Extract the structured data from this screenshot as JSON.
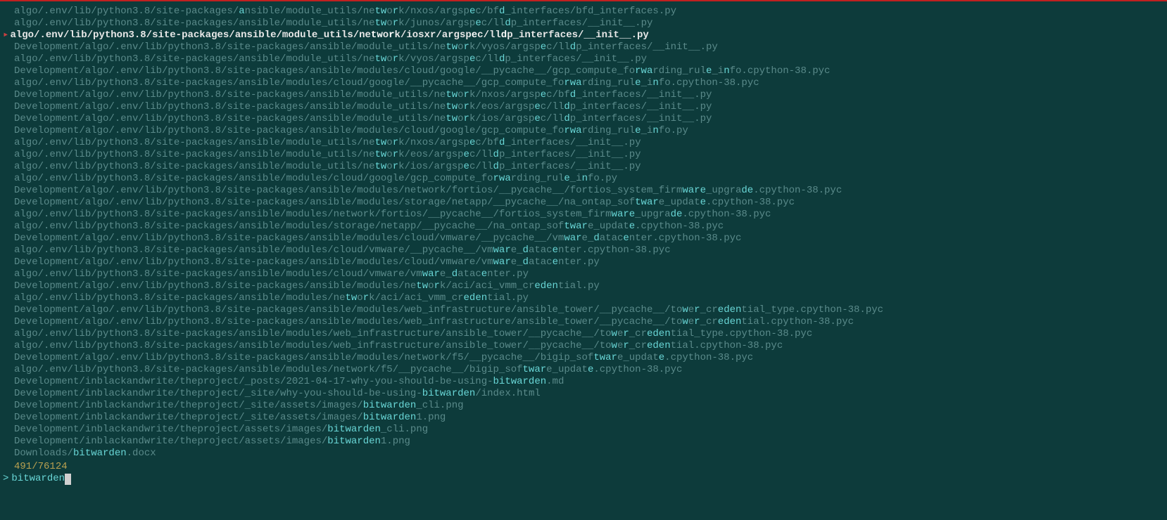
{
  "lines": [
    {
      "sel": false,
      "segs": [
        {
          "t": "algo/.env/lib/python3.8/site-packages/"
        },
        {
          "t": "a",
          "h": true
        },
        {
          "t": "nsible/module_utils/ne"
        },
        {
          "t": "tw",
          "h": true
        },
        {
          "t": "o"
        },
        {
          "t": "r",
          "h": true
        },
        {
          "t": "k/nxos/argsp"
        },
        {
          "t": "e",
          "h": true
        },
        {
          "t": "c/bf"
        },
        {
          "t": "d",
          "h": true
        },
        {
          "t": "_interfaces/bfd_interfaces.py"
        }
      ]
    },
    {
      "sel": false,
      "segs": [
        {
          "t": "algo/.env/lib/python3.8/site-packages/ansible/module_utils/ne"
        },
        {
          "t": "tw",
          "h": true
        },
        {
          "t": "o"
        },
        {
          "t": "r",
          "h": true
        },
        {
          "t": "k/junos/argsp"
        },
        {
          "t": "e",
          "h": true
        },
        {
          "t": "c/ll"
        },
        {
          "t": "d",
          "h": true
        },
        {
          "t": "p_interfaces/__init__.py"
        }
      ]
    },
    {
      "sel": true,
      "segs": [
        {
          "t": "algo/.env/lib/python3.8/site-packages/ansible/module_utils/ne"
        },
        {
          "t": "tw",
          "h": true
        },
        {
          "t": "o"
        },
        {
          "t": "r",
          "h": true
        },
        {
          "t": "k/iosxr/argsp"
        },
        {
          "t": "e",
          "h": true
        },
        {
          "t": "c/ll"
        },
        {
          "t": "d",
          "h": true
        },
        {
          "t": "p_interfaces/__init__.py"
        }
      ]
    },
    {
      "sel": false,
      "segs": [
        {
          "t": "Development/algo/.env/lib/python3.8/site-packages/ansible/module_utils/ne"
        },
        {
          "t": "tw",
          "h": true
        },
        {
          "t": "o"
        },
        {
          "t": "r",
          "h": true
        },
        {
          "t": "k/vyos/argsp"
        },
        {
          "t": "e",
          "h": true
        },
        {
          "t": "c/ll"
        },
        {
          "t": "d",
          "h": true
        },
        {
          "t": "p_interfaces/__init__.py"
        }
      ]
    },
    {
      "sel": false,
      "segs": [
        {
          "t": "algo/.env/lib/python3.8/site-packages/ansible/module_utils/ne"
        },
        {
          "t": "tw",
          "h": true
        },
        {
          "t": "o"
        },
        {
          "t": "r",
          "h": true
        },
        {
          "t": "k/vyos/argsp"
        },
        {
          "t": "e",
          "h": true
        },
        {
          "t": "c/ll"
        },
        {
          "t": "d",
          "h": true
        },
        {
          "t": "p_interfaces/__init__.py"
        }
      ]
    },
    {
      "sel": false,
      "segs": [
        {
          "t": "Development/algo/.env/lib/python3.8/site-packages/ansible/modules/cloud/google/__pycache__/gcp_compute_fo"
        },
        {
          "t": "rwa",
          "h": true
        },
        {
          "t": "rding_rul"
        },
        {
          "t": "e",
          "h": true
        },
        {
          "t": "_i"
        },
        {
          "t": "n",
          "h": true
        },
        {
          "t": "fo.cpython-38.pyc"
        }
      ]
    },
    {
      "sel": false,
      "segs": [
        {
          "t": "algo/.env/lib/python3.8/site-packages/ansible/modules/cloud/google/__pycache__/gcp_compute_fo"
        },
        {
          "t": "rwa",
          "h": true
        },
        {
          "t": "rding_rul"
        },
        {
          "t": "e",
          "h": true
        },
        {
          "t": "_i"
        },
        {
          "t": "n",
          "h": true
        },
        {
          "t": "fo.cpython-38.pyc"
        }
      ]
    },
    {
      "sel": false,
      "segs": [
        {
          "t": "Development/algo/.env/lib/python3.8/site-packages/ansible/module_utils/ne"
        },
        {
          "t": "tw",
          "h": true
        },
        {
          "t": "o"
        },
        {
          "t": "r",
          "h": true
        },
        {
          "t": "k/nxos/argsp"
        },
        {
          "t": "e",
          "h": true
        },
        {
          "t": "c/bf"
        },
        {
          "t": "d",
          "h": true
        },
        {
          "t": "_interfaces/__init__.py"
        }
      ]
    },
    {
      "sel": false,
      "segs": [
        {
          "t": "Development/algo/.env/lib/python3.8/site-packages/ansible/module_utils/ne"
        },
        {
          "t": "tw",
          "h": true
        },
        {
          "t": "o"
        },
        {
          "t": "r",
          "h": true
        },
        {
          "t": "k/eos/argsp"
        },
        {
          "t": "e",
          "h": true
        },
        {
          "t": "c/ll"
        },
        {
          "t": "d",
          "h": true
        },
        {
          "t": "p_interfaces/__init__.py"
        }
      ]
    },
    {
      "sel": false,
      "segs": [
        {
          "t": "Development/algo/.env/lib/python3.8/site-packages/ansible/module_utils/ne"
        },
        {
          "t": "tw",
          "h": true
        },
        {
          "t": "o"
        },
        {
          "t": "r",
          "h": true
        },
        {
          "t": "k/ios/argsp"
        },
        {
          "t": "e",
          "h": true
        },
        {
          "t": "c/ll"
        },
        {
          "t": "d",
          "h": true
        },
        {
          "t": "p_interfaces/__init__.py"
        }
      ]
    },
    {
      "sel": false,
      "segs": [
        {
          "t": "Development/algo/.env/lib/python3.8/site-packages/ansible/modules/cloud/google/gcp_compute_fo"
        },
        {
          "t": "rwa",
          "h": true
        },
        {
          "t": "rding_rul"
        },
        {
          "t": "e",
          "h": true
        },
        {
          "t": "_i"
        },
        {
          "t": "n",
          "h": true
        },
        {
          "t": "fo.py"
        }
      ]
    },
    {
      "sel": false,
      "segs": [
        {
          "t": "algo/.env/lib/python3.8/site-packages/ansible/module_utils/ne"
        },
        {
          "t": "tw",
          "h": true
        },
        {
          "t": "o"
        },
        {
          "t": "r",
          "h": true
        },
        {
          "t": "k/nxos/argsp"
        },
        {
          "t": "e",
          "h": true
        },
        {
          "t": "c/bf"
        },
        {
          "t": "d",
          "h": true
        },
        {
          "t": "_interfaces/__init__.py"
        }
      ]
    },
    {
      "sel": false,
      "segs": [
        {
          "t": "algo/.env/lib/python3.8/site-packages/ansible/module_utils/ne"
        },
        {
          "t": "tw",
          "h": true
        },
        {
          "t": "o"
        },
        {
          "t": "r",
          "h": true
        },
        {
          "t": "k/eos/argsp"
        },
        {
          "t": "e",
          "h": true
        },
        {
          "t": "c/ll"
        },
        {
          "t": "d",
          "h": true
        },
        {
          "t": "p_interfaces/__init__.py"
        }
      ]
    },
    {
      "sel": false,
      "segs": [
        {
          "t": "algo/.env/lib/python3.8/site-packages/ansible/module_utils/ne"
        },
        {
          "t": "tw",
          "h": true
        },
        {
          "t": "o"
        },
        {
          "t": "r",
          "h": true
        },
        {
          "t": "k/ios/argsp"
        },
        {
          "t": "e",
          "h": true
        },
        {
          "t": "c/ll"
        },
        {
          "t": "d",
          "h": true
        },
        {
          "t": "p_interfaces/__init__.py"
        }
      ]
    },
    {
      "sel": false,
      "segs": [
        {
          "t": "algo/.env/lib/python3.8/site-packages/ansible/modules/cloud/google/gcp_compute_fo"
        },
        {
          "t": "rwa",
          "h": true
        },
        {
          "t": "rding_rul"
        },
        {
          "t": "e",
          "h": true
        },
        {
          "t": "_i"
        },
        {
          "t": "n",
          "h": true
        },
        {
          "t": "fo.py"
        }
      ]
    },
    {
      "sel": false,
      "segs": [
        {
          "t": "Development/algo/.env/lib/python3.8/site-packages/ansible/modules/network/fortios/__pycache__/fortios_system_firm"
        },
        {
          "t": "ware",
          "h": true
        },
        {
          "t": "_upgra"
        },
        {
          "t": "de",
          "h": true
        },
        {
          "t": ".cpython-38.pyc"
        }
      ]
    },
    {
      "sel": false,
      "segs": [
        {
          "t": "Development/algo/.env/lib/python3.8/site-packages/ansible/modules/storage/netapp/__pycache__/na_ontap_sof"
        },
        {
          "t": "twar",
          "h": true
        },
        {
          "t": "e_updat"
        },
        {
          "t": "e",
          "h": true
        },
        {
          "t": ".cpython-38.pyc"
        }
      ]
    },
    {
      "sel": false,
      "segs": [
        {
          "t": "algo/.env/lib/python3.8/site-packages/ansible/modules/network/fortios/__pycache__/fortios_system_firm"
        },
        {
          "t": "ware",
          "h": true
        },
        {
          "t": "_upgra"
        },
        {
          "t": "de",
          "h": true
        },
        {
          "t": ".cpython-38.pyc"
        }
      ]
    },
    {
      "sel": false,
      "segs": [
        {
          "t": "algo/.env/lib/python3.8/site-packages/ansible/modules/storage/netapp/__pycache__/na_ontap_sof"
        },
        {
          "t": "twar",
          "h": true
        },
        {
          "t": "e_updat"
        },
        {
          "t": "e",
          "h": true
        },
        {
          "t": ".cpython-38.pyc"
        }
      ]
    },
    {
      "sel": false,
      "segs": [
        {
          "t": "Development/algo/.env/lib/python3.8/site-packages/ansible/modules/cloud/vmware/__pycache__/vm"
        },
        {
          "t": "war",
          "h": true
        },
        {
          "t": "e_"
        },
        {
          "t": "d",
          "h": true
        },
        {
          "t": "atac"
        },
        {
          "t": "e",
          "h": true
        },
        {
          "t": "nter.cpython-38.pyc"
        }
      ]
    },
    {
      "sel": false,
      "segs": [
        {
          "t": "algo/.env/lib/python3.8/site-packages/ansible/modules/cloud/vmware/__pycache__/vm"
        },
        {
          "t": "war",
          "h": true
        },
        {
          "t": "e_"
        },
        {
          "t": "d",
          "h": true
        },
        {
          "t": "atac"
        },
        {
          "t": "e",
          "h": true
        },
        {
          "t": "nter.cpython-38.pyc"
        }
      ]
    },
    {
      "sel": false,
      "segs": [
        {
          "t": "Development/algo/.env/lib/python3.8/site-packages/ansible/modules/cloud/vmware/vm"
        },
        {
          "t": "war",
          "h": true
        },
        {
          "t": "e_"
        },
        {
          "t": "d",
          "h": true
        },
        {
          "t": "atac"
        },
        {
          "t": "e",
          "h": true
        },
        {
          "t": "nter.py"
        }
      ]
    },
    {
      "sel": false,
      "segs": [
        {
          "t": "algo/.env/lib/python3.8/site-packages/ansible/modules/cloud/vmware/vm"
        },
        {
          "t": "war",
          "h": true
        },
        {
          "t": "e_"
        },
        {
          "t": "d",
          "h": true
        },
        {
          "t": "atac"
        },
        {
          "t": "e",
          "h": true
        },
        {
          "t": "nter.py"
        }
      ]
    },
    {
      "sel": false,
      "segs": [
        {
          "t": "Development/algo/.env/lib/python3.8/site-packages/ansible/modules/ne"
        },
        {
          "t": "tw",
          "h": true
        },
        {
          "t": "o"
        },
        {
          "t": "r",
          "h": true
        },
        {
          "t": "k/aci/aci_vmm_cr"
        },
        {
          "t": "eden",
          "h": true
        },
        {
          "t": "tial.py"
        }
      ]
    },
    {
      "sel": false,
      "segs": [
        {
          "t": "algo/.env/lib/python3.8/site-packages/ansible/modules/ne"
        },
        {
          "t": "tw",
          "h": true
        },
        {
          "t": "o"
        },
        {
          "t": "r",
          "h": true
        },
        {
          "t": "k/aci/aci_vmm_cr"
        },
        {
          "t": "eden",
          "h": true
        },
        {
          "t": "tial.py"
        }
      ]
    },
    {
      "sel": false,
      "segs": [
        {
          "t": "Development/algo/.env/lib/python3.8/site-packages/ansible/modules/web_infrastructure/ansible_tower/__pycache__/to"
        },
        {
          "t": "w",
          "h": true
        },
        {
          "t": "e"
        },
        {
          "t": "r",
          "h": true
        },
        {
          "t": "_cr"
        },
        {
          "t": "eden",
          "h": true
        },
        {
          "t": "tial_type.cpython-38.pyc"
        }
      ]
    },
    {
      "sel": false,
      "segs": [
        {
          "t": "Development/algo/.env/lib/python3.8/site-packages/ansible/modules/web_infrastructure/ansible_tower/__pycache__/to"
        },
        {
          "t": "w",
          "h": true
        },
        {
          "t": "e"
        },
        {
          "t": "r",
          "h": true
        },
        {
          "t": "_cr"
        },
        {
          "t": "eden",
          "h": true
        },
        {
          "t": "tial.cpython-38.pyc"
        }
      ]
    },
    {
      "sel": false,
      "segs": [
        {
          "t": "algo/.env/lib/python3.8/site-packages/ansible/modules/web_infrastructure/ansible_tower/__pycache__/to"
        },
        {
          "t": "w",
          "h": true
        },
        {
          "t": "e"
        },
        {
          "t": "r",
          "h": true
        },
        {
          "t": "_cr"
        },
        {
          "t": "eden",
          "h": true
        },
        {
          "t": "tial_type.cpython-38.pyc"
        }
      ]
    },
    {
      "sel": false,
      "segs": [
        {
          "t": "algo/.env/lib/python3.8/site-packages/ansible/modules/web_infrastructure/ansible_tower/__pycache__/to"
        },
        {
          "t": "w",
          "h": true
        },
        {
          "t": "e"
        },
        {
          "t": "r",
          "h": true
        },
        {
          "t": "_cr"
        },
        {
          "t": "eden",
          "h": true
        },
        {
          "t": "tial.cpython-38.pyc"
        }
      ]
    },
    {
      "sel": false,
      "segs": [
        {
          "t": "Development/algo/.env/lib/python3.8/site-packages/ansible/modules/network/f5/__pycache__/bigip_sof"
        },
        {
          "t": "twar",
          "h": true
        },
        {
          "t": "e_updat"
        },
        {
          "t": "e",
          "h": true
        },
        {
          "t": ".cpython-38.pyc"
        }
      ]
    },
    {
      "sel": false,
      "segs": [
        {
          "t": "algo/.env/lib/python3.8/site-packages/ansible/modules/network/f5/__pycache__/bigip_sof"
        },
        {
          "t": "twar",
          "h": true
        },
        {
          "t": "e_updat"
        },
        {
          "t": "e",
          "h": true
        },
        {
          "t": ".cpython-38.pyc"
        }
      ]
    },
    {
      "sel": false,
      "segs": [
        {
          "t": "Development/inblackandwrite/theproject/_posts/2021-04-17-why-you-should-be-using-"
        },
        {
          "t": "bitwarden",
          "h": true
        },
        {
          "t": ".md"
        }
      ]
    },
    {
      "sel": false,
      "segs": [
        {
          "t": "Development/inblackandwrite/theproject/_site/why-you-should-be-using-"
        },
        {
          "t": "bitwarden",
          "h": true
        },
        {
          "t": "/index.html"
        }
      ]
    },
    {
      "sel": false,
      "segs": [
        {
          "t": "Development/inblackandwrite/theproject/_site/assets/images/"
        },
        {
          "t": "bitwarden",
          "h": true
        },
        {
          "t": "_cli.png"
        }
      ]
    },
    {
      "sel": false,
      "segs": [
        {
          "t": "Development/inblackandwrite/theproject/_site/assets/images/"
        },
        {
          "t": "bitwarden",
          "h": true
        },
        {
          "t": "1.png"
        }
      ]
    },
    {
      "sel": false,
      "segs": [
        {
          "t": "Development/inblackandwrite/theproject/assets/images/"
        },
        {
          "t": "bitwarden",
          "h": true
        },
        {
          "t": "_cli.png"
        }
      ]
    },
    {
      "sel": false,
      "segs": [
        {
          "t": "Development/inblackandwrite/theproject/assets/images/"
        },
        {
          "t": "bitwarden",
          "h": true
        },
        {
          "t": "1.png"
        }
      ]
    },
    {
      "sel": false,
      "segs": [
        {
          "t": "Downloads/"
        },
        {
          "t": "bitwarden",
          "h": true
        },
        {
          "t": ".docx"
        }
      ]
    }
  ],
  "status": {
    "matches": "491",
    "total": "76124"
  },
  "prompt": {
    "caret": ">",
    "query": "bitwarden"
  }
}
